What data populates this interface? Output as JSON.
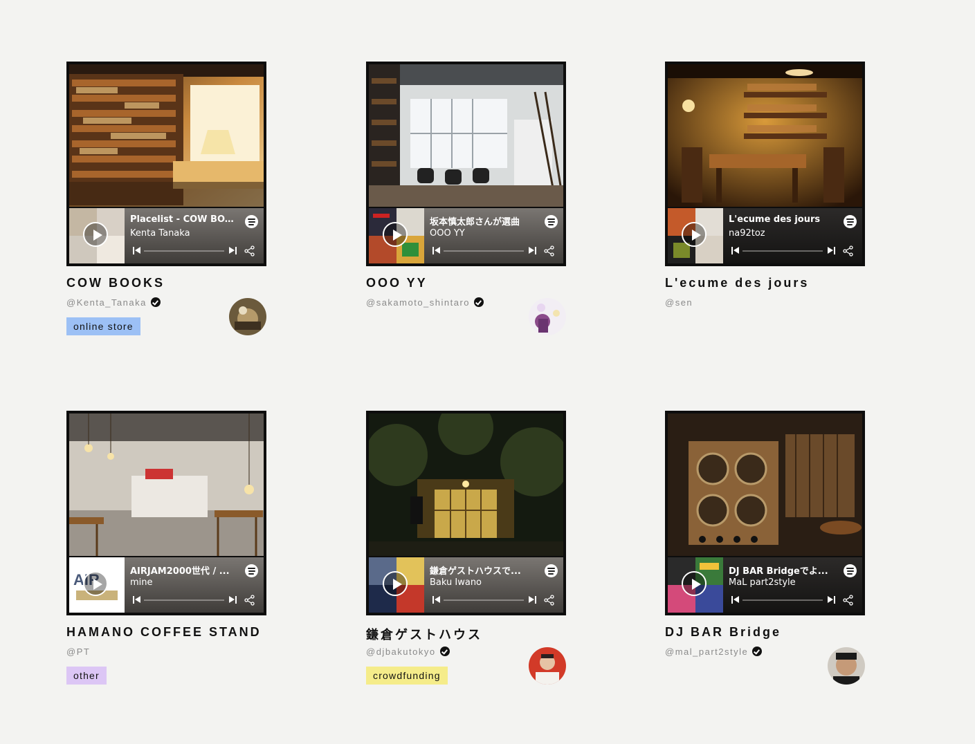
{
  "cards": [
    {
      "name": "COW BOOKS",
      "handle": "@Kenta_Tanaka",
      "verified": true,
      "tag": "online store",
      "tag_color": "#9cc0f5",
      "player": {
        "title": "Placelist - COW BO...",
        "artist": "Kenta Tanaka"
      }
    },
    {
      "name": "OOO YY",
      "handle": "@sakamoto_shintaro",
      "verified": true,
      "tag": "",
      "player": {
        "title": "坂本慎太郎さんが選曲",
        "artist": "OOO YY"
      }
    },
    {
      "name": "L'ecume des jours",
      "handle": "@sen",
      "verified": false,
      "tag": "",
      "player": {
        "title": "L'ecume des jours",
        "artist": "na92toz"
      }
    },
    {
      "name": "HAMANO COFFEE STAND",
      "handle": "@PT",
      "verified": false,
      "tag": "other",
      "tag_color": "#dcc6f5",
      "player": {
        "title": "AIRJAM2000世代 / ...",
        "artist": "mine"
      }
    },
    {
      "name": "鎌倉ゲストハウス",
      "handle": "@djbakutokyo",
      "verified": true,
      "tag": "crowdfunding",
      "tag_color": "#f5ec8a",
      "player": {
        "title": "鎌倉ゲストハウスで...",
        "artist": "Baku Iwano"
      }
    },
    {
      "name": "DJ BAR Bridge",
      "handle": "@mal_part2style",
      "verified": true,
      "tag": "",
      "player": {
        "title": "DJ BAR Bridgeでよ...",
        "artist": "MaL part2style"
      }
    }
  ],
  "icons": {
    "play": "play-icon",
    "spotify": "spotify-icon",
    "previous": "previous-track-icon",
    "next": "next-track-icon",
    "share": "share-icon",
    "verified": "verified-badge-icon"
  }
}
